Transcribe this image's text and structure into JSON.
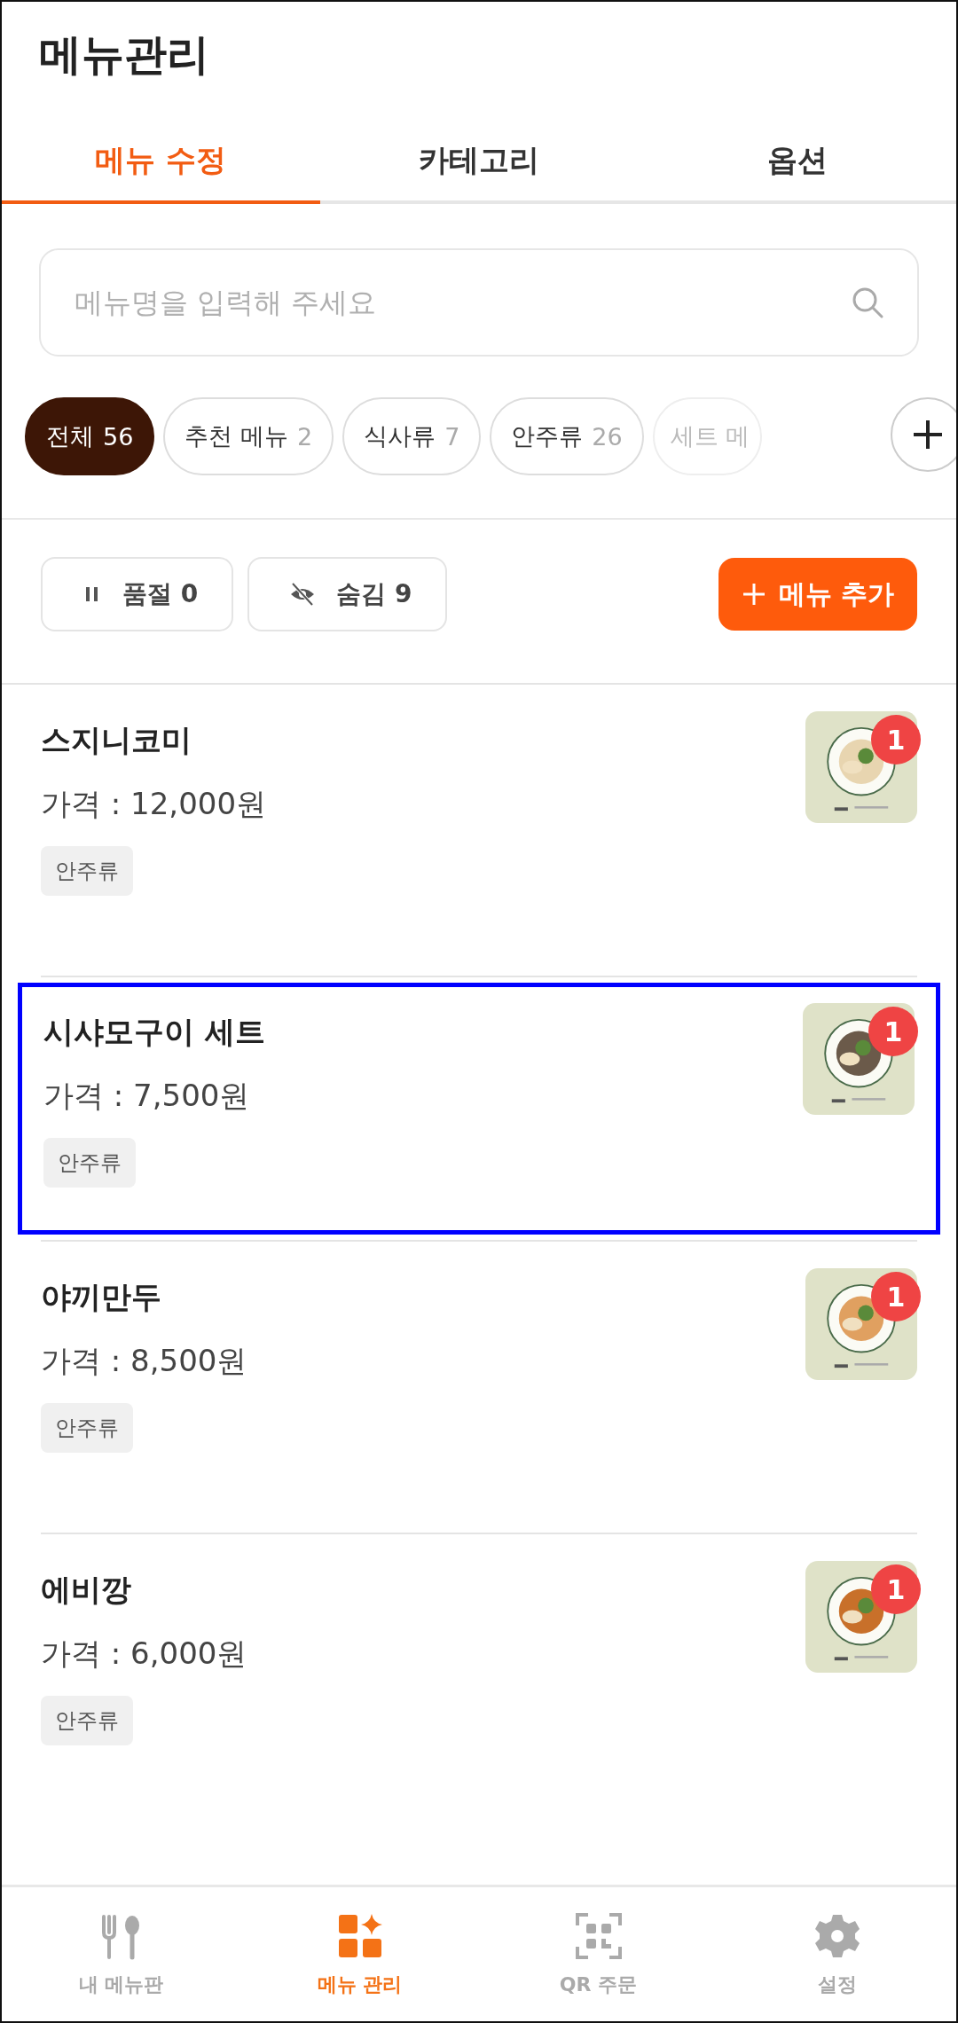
{
  "title": "메뉴관리",
  "tabs": [
    {
      "label": "메뉴 수정",
      "selected": true
    },
    {
      "label": "카테고리",
      "selected": false
    },
    {
      "label": "옵션",
      "selected": false
    }
  ],
  "search": {
    "placeholder": "메뉴명을 입력해 주세요"
  },
  "chips": [
    {
      "label": "전체",
      "count": "56",
      "selected": true
    },
    {
      "label": "추천 메뉴",
      "count": "2",
      "selected": false
    },
    {
      "label": "식사류",
      "count": "7",
      "selected": false
    },
    {
      "label": "안주류",
      "count": "26",
      "selected": false
    },
    {
      "label": "세트 메",
      "selected": false
    }
  ],
  "filters": [
    {
      "kind": "pause",
      "label": "품절 0"
    },
    {
      "kind": "hidden",
      "label": "숨김 9"
    }
  ],
  "add_button": {
    "label": "메뉴 추가"
  },
  "items": [
    {
      "name": "스지니코미",
      "price": "가격 : 12,000원",
      "tag": "안주류",
      "badge": "1",
      "selected": false,
      "kind": "picture"
    },
    {
      "name": "시샤모구이 세트",
      "price": "가격 : 7,500원",
      "tag": "안주류",
      "badge": "1",
      "selected": true,
      "kind": "picture"
    },
    {
      "name": "야끼만두",
      "price": "가격 : 8,500원",
      "tag": "안주류",
      "badge": "1",
      "selected": false,
      "kind": "picture"
    },
    {
      "name": "에비깡",
      "price": "가격 : 6,000원",
      "tag": "안주류",
      "badge": "1",
      "selected": false,
      "kind": "picture"
    }
  ],
  "nav": [
    {
      "label": "내 메뉴판",
      "selected": false
    },
    {
      "label": "메뉴 관리",
      "selected": true
    },
    {
      "label": "QR 주문",
      "selected": false
    },
    {
      "label": "설정",
      "selected": false
    }
  ]
}
